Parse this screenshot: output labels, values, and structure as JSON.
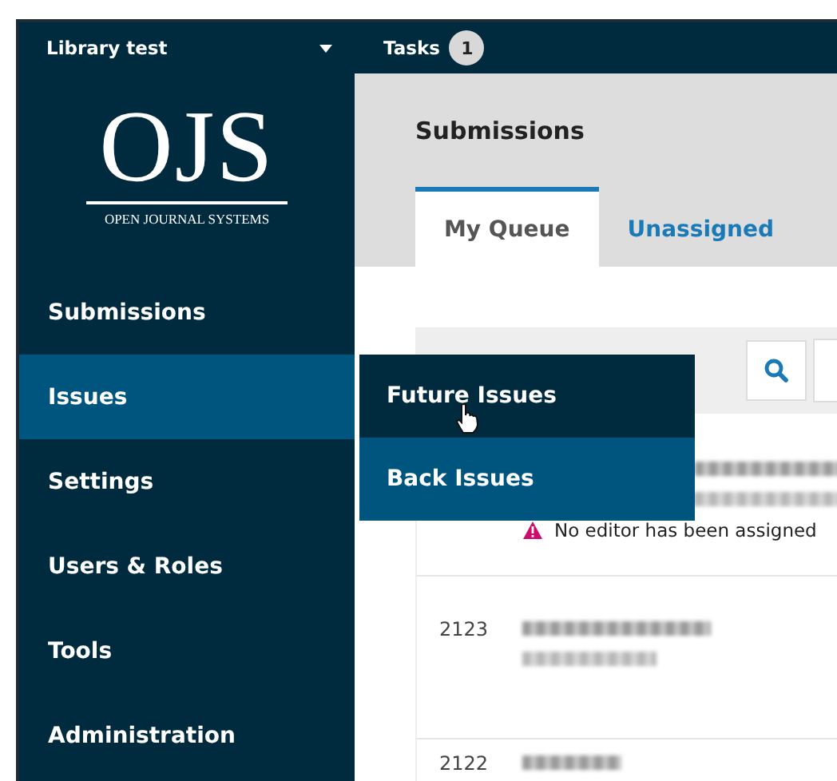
{
  "top_bar": {
    "context": "Library test",
    "tasks_label": "Tasks",
    "tasks_count": "1"
  },
  "logo": {
    "mark": "OJS",
    "tagline": "OPEN JOURNAL SYSTEMS"
  },
  "sidebar": {
    "items": [
      {
        "label": "Submissions",
        "selected": false
      },
      {
        "label": "Issues",
        "selected": true
      },
      {
        "label": "Settings",
        "selected": false
      },
      {
        "label": "Users & Roles",
        "selected": false
      },
      {
        "label": "Tools",
        "selected": false
      },
      {
        "label": "Administration",
        "selected": false
      }
    ]
  },
  "submenu": {
    "items": [
      {
        "label": "Future Issues",
        "hovered": true
      },
      {
        "label": "Back Issues",
        "hovered": false
      }
    ]
  },
  "page_title": "Submissions",
  "tabs": [
    {
      "label": "My Queue",
      "selected": true
    },
    {
      "label": "Unassigned",
      "selected": false
    }
  ],
  "rows": [
    {
      "warning": "No editor has been assigned"
    },
    {
      "id": "2123"
    },
    {
      "id": "2122"
    }
  ]
}
